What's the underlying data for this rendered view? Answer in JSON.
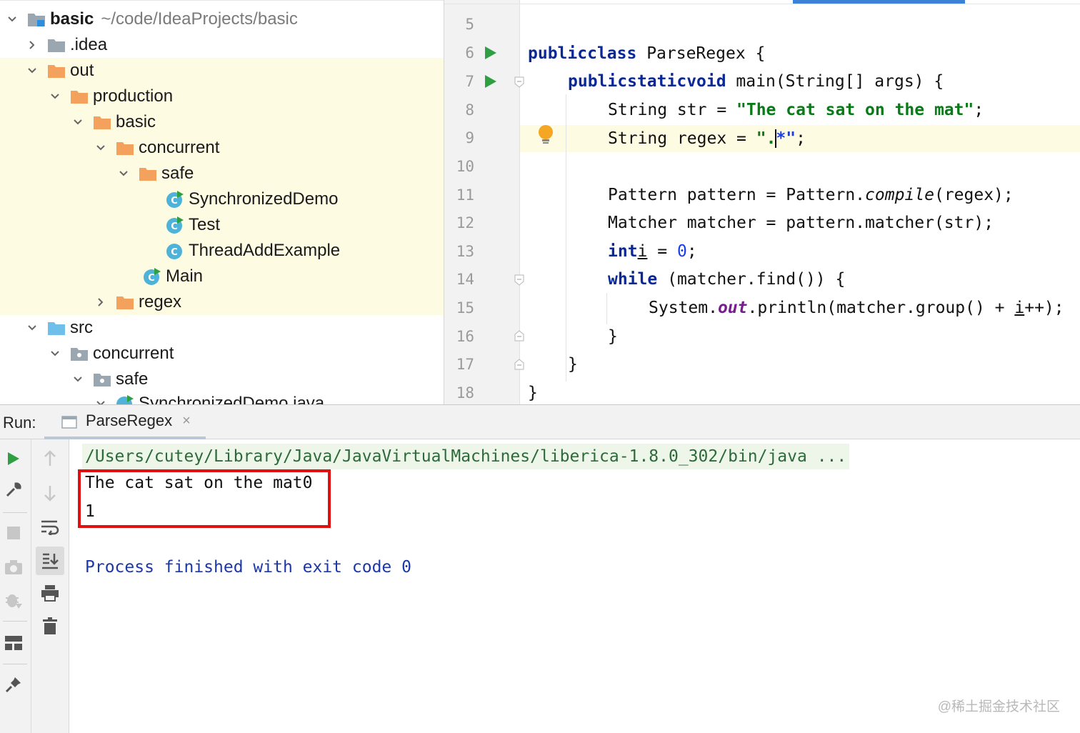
{
  "project_tree": {
    "root": {
      "name": "basic",
      "path": "~/code/IdeaProjects/basic"
    },
    "items": [
      {
        "label": "basic"
      },
      {
        "label": ".idea"
      },
      {
        "label": "out"
      },
      {
        "label": "production"
      },
      {
        "label": "basic"
      },
      {
        "label": "concurrent"
      },
      {
        "label": "safe"
      },
      {
        "label": "SynchronizedDemo"
      },
      {
        "label": "Test"
      },
      {
        "label": "ThreadAddExample"
      },
      {
        "label": "Main"
      },
      {
        "label": "regex"
      },
      {
        "label": "src"
      },
      {
        "label": "concurrent"
      },
      {
        "label": "safe"
      },
      {
        "label": "SynchronizedDemo.java"
      }
    ]
  },
  "editor": {
    "line_numbers": [
      "5",
      "6",
      "7",
      "8",
      "9",
      "10",
      "11",
      "12",
      "13",
      "14",
      "15",
      "16",
      "17",
      "18"
    ],
    "code": {
      "l6_kw1": "public",
      "l6_kw2": "class",
      "l6_rest": " ParseRegex {",
      "l7_kw1": "public",
      "l7_kw2": "static",
      "l7_kw3": "void",
      "l7_rest": " main(String[] args) {",
      "l8_a": "String str = ",
      "l8_str": "\"The cat sat on the mat\"",
      "l8_b": ";",
      "l9_a": "String regex = ",
      "l9_str1": "\".",
      "l9_str2": "*\"",
      "l9_b": ";",
      "l11_a": "Pattern pattern = Pattern.",
      "l11_ital": "compile",
      "l11_b": "(regex);",
      "l12": "Matcher matcher = pattern.matcher(str);",
      "l13_kw": "int",
      "l13_var": "i",
      "l13_eq": " = ",
      "l13_num": "0",
      "l13_end": ";",
      "l14_kw": "while",
      "l14_rest": " (matcher.find()) {",
      "l15_a": "System.",
      "l15_fld": "out",
      "l15_b": ".println(matcher.group() + ",
      "l15_var": "i",
      "l15_c": "++);",
      "l16": "}",
      "l17": "}",
      "l18": "}"
    }
  },
  "run_panel": {
    "label": "Run:",
    "tab": "ParseRegex",
    "tab_close": "×",
    "console": {
      "command": "/Users/cutey/Library/Java/JavaVirtualMachines/liberica-1.8.0_302/bin/java ...",
      "output_lines": [
        "The cat sat on the mat0",
        "1"
      ],
      "process": "Process finished with exit code 0"
    }
  },
  "watermark": "@稀土掘金技术社区",
  "colors": {
    "keyword": "#0a2896",
    "string": "#097a17",
    "number": "#1a3de8",
    "highlight": "#fdfbe2",
    "run_green": "#2ea043",
    "red_box": "#e01010"
  }
}
